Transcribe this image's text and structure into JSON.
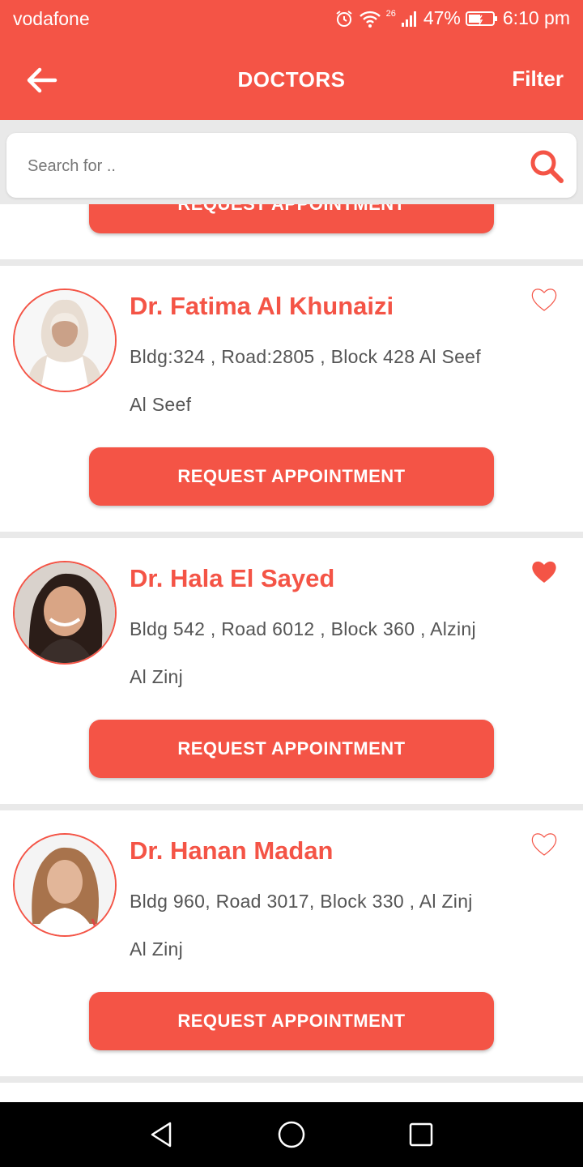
{
  "status_bar": {
    "carrier": "vodafone",
    "network": "26",
    "battery": "47%",
    "time": "6:10 pm"
  },
  "header": {
    "title": "DOCTORS",
    "filter_label": "Filter"
  },
  "search": {
    "placeholder": "Search for .."
  },
  "partial_card": {
    "button_label": "REQUEST APPOINTMENT"
  },
  "doctors": [
    {
      "name": "Dr. Fatima Al Khunaizi",
      "address": "Bldg:324 , Road:2805 , Block 428 Al Seef",
      "area": "Al Seef",
      "favorite": false,
      "button_label": "REQUEST APPOINTMENT"
    },
    {
      "name": "Dr. Hala El Sayed",
      "address": "Bldg 542 , Road 6012 , Block 360 , Alzinj",
      "area": "Al Zinj",
      "favorite": true,
      "button_label": "REQUEST APPOINTMENT"
    },
    {
      "name": "Dr. Hanan Madan",
      "address": "Bldg 960, Road 3017, Block 330 , Al Zinj",
      "area": "Al Zinj",
      "favorite": false,
      "button_label": "REQUEST APPOINTMENT"
    }
  ],
  "colors": {
    "accent": "#f45446",
    "separator": "#e9e9e9",
    "text_secondary": "#555555"
  },
  "icons": {
    "back": "arrow-left-icon",
    "search": "search-icon",
    "favorite": "heart-icon",
    "nav_back": "triangle-back-icon",
    "nav_home": "circle-home-icon",
    "nav_recents": "square-recents-icon"
  }
}
